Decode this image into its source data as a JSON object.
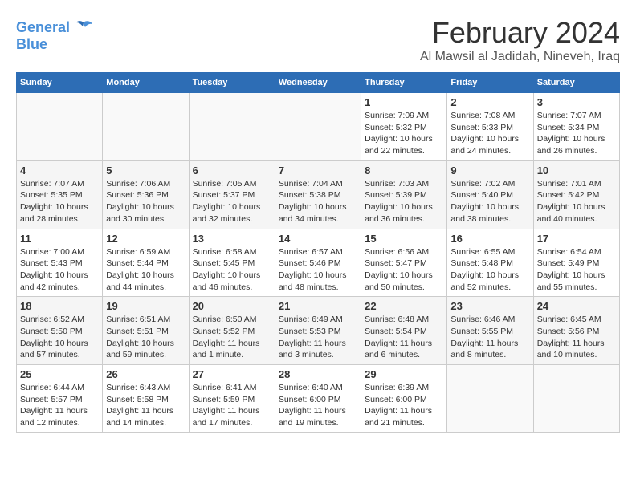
{
  "header": {
    "logo_line1": "General",
    "logo_line2": "Blue",
    "month_year": "February 2024",
    "location": "Al Mawsil al Jadidah, Nineveh, Iraq"
  },
  "weekdays": [
    "Sunday",
    "Monday",
    "Tuesday",
    "Wednesday",
    "Thursday",
    "Friday",
    "Saturday"
  ],
  "weeks": [
    [
      {
        "day": "",
        "sunrise": "",
        "sunset": "",
        "daylight": ""
      },
      {
        "day": "",
        "sunrise": "",
        "sunset": "",
        "daylight": ""
      },
      {
        "day": "",
        "sunrise": "",
        "sunset": "",
        "daylight": ""
      },
      {
        "day": "",
        "sunrise": "",
        "sunset": "",
        "daylight": ""
      },
      {
        "day": "1",
        "sunrise": "Sunrise: 7:09 AM",
        "sunset": "Sunset: 5:32 PM",
        "daylight": "Daylight: 10 hours and 22 minutes."
      },
      {
        "day": "2",
        "sunrise": "Sunrise: 7:08 AM",
        "sunset": "Sunset: 5:33 PM",
        "daylight": "Daylight: 10 hours and 24 minutes."
      },
      {
        "day": "3",
        "sunrise": "Sunrise: 7:07 AM",
        "sunset": "Sunset: 5:34 PM",
        "daylight": "Daylight: 10 hours and 26 minutes."
      }
    ],
    [
      {
        "day": "4",
        "sunrise": "Sunrise: 7:07 AM",
        "sunset": "Sunset: 5:35 PM",
        "daylight": "Daylight: 10 hours and 28 minutes."
      },
      {
        "day": "5",
        "sunrise": "Sunrise: 7:06 AM",
        "sunset": "Sunset: 5:36 PM",
        "daylight": "Daylight: 10 hours and 30 minutes."
      },
      {
        "day": "6",
        "sunrise": "Sunrise: 7:05 AM",
        "sunset": "Sunset: 5:37 PM",
        "daylight": "Daylight: 10 hours and 32 minutes."
      },
      {
        "day": "7",
        "sunrise": "Sunrise: 7:04 AM",
        "sunset": "Sunset: 5:38 PM",
        "daylight": "Daylight: 10 hours and 34 minutes."
      },
      {
        "day": "8",
        "sunrise": "Sunrise: 7:03 AM",
        "sunset": "Sunset: 5:39 PM",
        "daylight": "Daylight: 10 hours and 36 minutes."
      },
      {
        "day": "9",
        "sunrise": "Sunrise: 7:02 AM",
        "sunset": "Sunset: 5:40 PM",
        "daylight": "Daylight: 10 hours and 38 minutes."
      },
      {
        "day": "10",
        "sunrise": "Sunrise: 7:01 AM",
        "sunset": "Sunset: 5:42 PM",
        "daylight": "Daylight: 10 hours and 40 minutes."
      }
    ],
    [
      {
        "day": "11",
        "sunrise": "Sunrise: 7:00 AM",
        "sunset": "Sunset: 5:43 PM",
        "daylight": "Daylight: 10 hours and 42 minutes."
      },
      {
        "day": "12",
        "sunrise": "Sunrise: 6:59 AM",
        "sunset": "Sunset: 5:44 PM",
        "daylight": "Daylight: 10 hours and 44 minutes."
      },
      {
        "day": "13",
        "sunrise": "Sunrise: 6:58 AM",
        "sunset": "Sunset: 5:45 PM",
        "daylight": "Daylight: 10 hours and 46 minutes."
      },
      {
        "day": "14",
        "sunrise": "Sunrise: 6:57 AM",
        "sunset": "Sunset: 5:46 PM",
        "daylight": "Daylight: 10 hours and 48 minutes."
      },
      {
        "day": "15",
        "sunrise": "Sunrise: 6:56 AM",
        "sunset": "Sunset: 5:47 PM",
        "daylight": "Daylight: 10 hours and 50 minutes."
      },
      {
        "day": "16",
        "sunrise": "Sunrise: 6:55 AM",
        "sunset": "Sunset: 5:48 PM",
        "daylight": "Daylight: 10 hours and 52 minutes."
      },
      {
        "day": "17",
        "sunrise": "Sunrise: 6:54 AM",
        "sunset": "Sunset: 5:49 PM",
        "daylight": "Daylight: 10 hours and 55 minutes."
      }
    ],
    [
      {
        "day": "18",
        "sunrise": "Sunrise: 6:52 AM",
        "sunset": "Sunset: 5:50 PM",
        "daylight": "Daylight: 10 hours and 57 minutes."
      },
      {
        "day": "19",
        "sunrise": "Sunrise: 6:51 AM",
        "sunset": "Sunset: 5:51 PM",
        "daylight": "Daylight: 10 hours and 59 minutes."
      },
      {
        "day": "20",
        "sunrise": "Sunrise: 6:50 AM",
        "sunset": "Sunset: 5:52 PM",
        "daylight": "Daylight: 11 hours and 1 minute."
      },
      {
        "day": "21",
        "sunrise": "Sunrise: 6:49 AM",
        "sunset": "Sunset: 5:53 PM",
        "daylight": "Daylight: 11 hours and 3 minutes."
      },
      {
        "day": "22",
        "sunrise": "Sunrise: 6:48 AM",
        "sunset": "Sunset: 5:54 PM",
        "daylight": "Daylight: 11 hours and 6 minutes."
      },
      {
        "day": "23",
        "sunrise": "Sunrise: 6:46 AM",
        "sunset": "Sunset: 5:55 PM",
        "daylight": "Daylight: 11 hours and 8 minutes."
      },
      {
        "day": "24",
        "sunrise": "Sunrise: 6:45 AM",
        "sunset": "Sunset: 5:56 PM",
        "daylight": "Daylight: 11 hours and 10 minutes."
      }
    ],
    [
      {
        "day": "25",
        "sunrise": "Sunrise: 6:44 AM",
        "sunset": "Sunset: 5:57 PM",
        "daylight": "Daylight: 11 hours and 12 minutes."
      },
      {
        "day": "26",
        "sunrise": "Sunrise: 6:43 AM",
        "sunset": "Sunset: 5:58 PM",
        "daylight": "Daylight: 11 hours and 14 minutes."
      },
      {
        "day": "27",
        "sunrise": "Sunrise: 6:41 AM",
        "sunset": "Sunset: 5:59 PM",
        "daylight": "Daylight: 11 hours and 17 minutes."
      },
      {
        "day": "28",
        "sunrise": "Sunrise: 6:40 AM",
        "sunset": "Sunset: 6:00 PM",
        "daylight": "Daylight: 11 hours and 19 minutes."
      },
      {
        "day": "29",
        "sunrise": "Sunrise: 6:39 AM",
        "sunset": "Sunset: 6:00 PM",
        "daylight": "Daylight: 11 hours and 21 minutes."
      },
      {
        "day": "",
        "sunrise": "",
        "sunset": "",
        "daylight": ""
      },
      {
        "day": "",
        "sunrise": "",
        "sunset": "",
        "daylight": ""
      }
    ]
  ]
}
